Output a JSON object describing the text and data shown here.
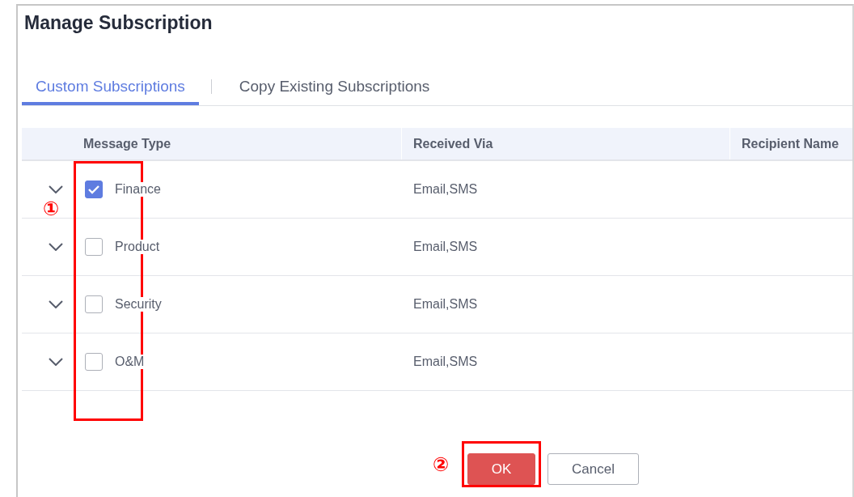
{
  "dialog": {
    "title": "Manage Subscription"
  },
  "tabs": [
    {
      "label": "Custom Subscriptions",
      "selected": true
    },
    {
      "label": "Copy Existing Subscriptions",
      "selected": false
    }
  ],
  "table": {
    "columns": [
      "Message Type",
      "Received Via",
      "Recipient Name"
    ],
    "rows": [
      {
        "message_type": "Finance",
        "received_via": "Email,SMS",
        "checked": true
      },
      {
        "message_type": "Product",
        "received_via": "Email,SMS",
        "checked": false
      },
      {
        "message_type": "Security",
        "received_via": "Email,SMS",
        "checked": false
      },
      {
        "message_type": "O&M",
        "received_via": "Email,SMS",
        "checked": false
      }
    ]
  },
  "buttons": [
    {
      "label": "OK",
      "kind": "primary"
    },
    {
      "label": "Cancel",
      "kind": "secondary"
    }
  ],
  "annotations": [
    {
      "label": "①",
      "kind": "column-frame"
    },
    {
      "label": "②",
      "kind": "button-frame"
    }
  ]
}
